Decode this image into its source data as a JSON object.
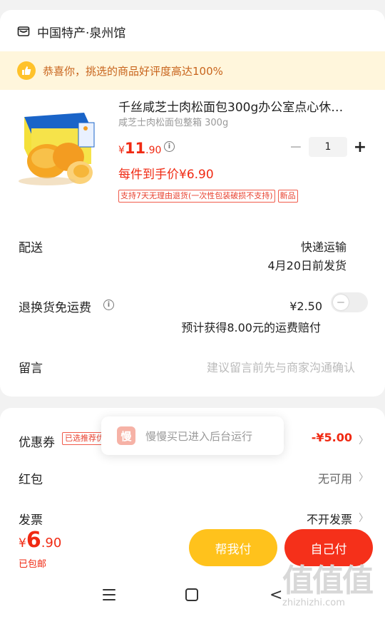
{
  "shop": {
    "name": "中国特产·泉州馆",
    "icon": "shop-icon"
  },
  "banner": {
    "text": "恭喜你，挑选的商品好评度高达100%",
    "icon": "thumbs-up-icon"
  },
  "product": {
    "title": "千丝咸芝士肉松面包300g办公室点心休…",
    "spec": "咸芝士肉松面包整箱 300g",
    "price_currency": "¥",
    "price_int": "11",
    "price_dec": ".90",
    "unit_price": "每件到手价¥6.90",
    "quantity": "1",
    "tags": [
      "支持7天无理由退货(一次性包装破损不支持)",
      "新品"
    ]
  },
  "delivery": {
    "label": "配送",
    "method": "快递运输",
    "ship_date": "4月20日前发货"
  },
  "return_insurance": {
    "label": "退换货免运费",
    "price": "¥2.50",
    "note": "预计获得8.00元的运费赔付",
    "enabled": false
  },
  "message": {
    "label": "留言",
    "placeholder": "建议留言前先与商家沟通确认"
  },
  "coupon": {
    "label": "优惠券",
    "tag": "已选推荐优惠",
    "value": "-¥5.00"
  },
  "red_packet": {
    "label": "红包",
    "value": "无可用"
  },
  "invoice": {
    "label": "发票",
    "value": "不开发票"
  },
  "toast": {
    "icon_char": "慢",
    "text": "慢慢买已进入后台运行"
  },
  "total": {
    "currency": "¥",
    "int": "6",
    "dec": ".90",
    "shipping": "已包邮"
  },
  "buttons": {
    "help_pay": "帮我付",
    "self_pay": "自己付"
  },
  "watermark": {
    "big": "值值值",
    "small": "zhizhizhi.com"
  },
  "colors": {
    "accent": "#f02a13",
    "help_button": "#ffc21c",
    "pay_button": "#f5301a",
    "banner_bg": "#fff6dc"
  }
}
